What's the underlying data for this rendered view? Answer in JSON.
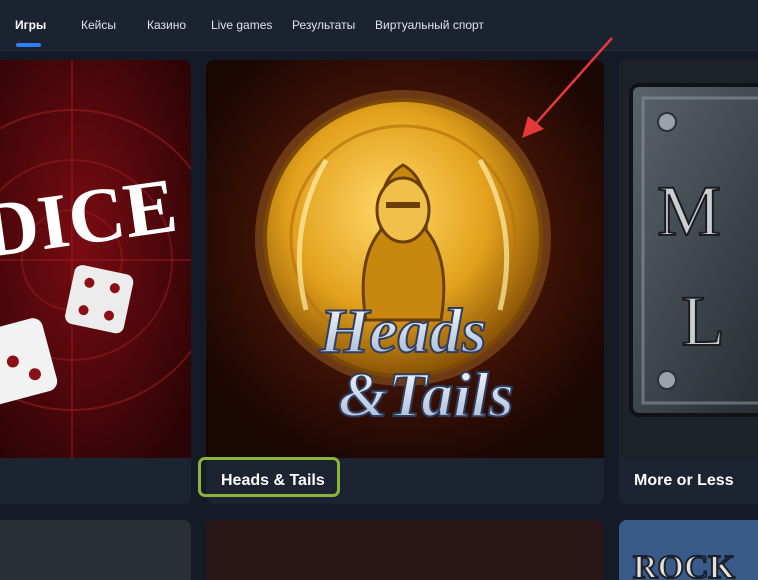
{
  "nav": {
    "items": [
      "Игры",
      "Кейсы",
      "Казино",
      "Live games",
      "Результаты",
      "Виртуальный спорт"
    ],
    "active_index": 0
  },
  "cards": [
    {
      "title": "",
      "art_text": "DICE"
    },
    {
      "title": "Heads & Tails",
      "art_text_1": "Heads",
      "art_text_2": "&Tails"
    },
    {
      "title": "More or Less",
      "art_text_1": "M",
      "art_text_2": "L"
    }
  ],
  "row2": {
    "art_text": "ROCK"
  },
  "colors": {
    "background": "#151b26",
    "nav_background": "#1b2230",
    "accent_underline": "#2d7ff9",
    "highlight_border": "#8ab53a",
    "annotation_arrow": "#e5383b"
  }
}
